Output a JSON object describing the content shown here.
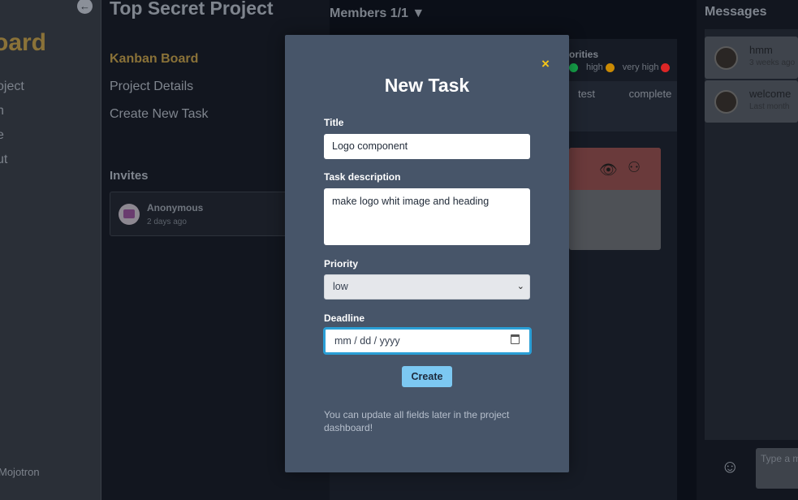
{
  "left_sidebar": {
    "collapse_icon": "arrow-left-icon",
    "brand": "oard",
    "items": [
      "oject",
      "h",
      "e",
      "ut"
    ],
    "user": "Mojotron"
  },
  "project": {
    "title": "Top Secret Project",
    "nav": [
      "Kanban Board",
      "Project Details",
      "Create New Task"
    ],
    "invites_heading": "Invites",
    "invite": {
      "name": "Anonymous",
      "time": "2 days ago"
    }
  },
  "board": {
    "members": "Members 1/1 ▼",
    "priorities_heading": "orities",
    "legend": [
      {
        "label": "high",
        "color": "#ca8a04"
      },
      {
        "label": "very high",
        "color": "#dc2626"
      }
    ],
    "legend_first_dot": "#16a34a",
    "columns": [
      "test",
      "complete"
    ]
  },
  "messages": {
    "heading": "Messages",
    "items": [
      {
        "name": "hmm",
        "time": "3 weeks ago"
      },
      {
        "name": "welcome",
        "time": "Last month"
      }
    ],
    "input_placeholder": "Type a m"
  },
  "modal": {
    "title": "New Task",
    "close_icon": "×",
    "title_label": "Title",
    "title_value": "Logo component",
    "description_label": "Task description",
    "description_value": "make logo whit image and heading",
    "priority_label": "Priority",
    "priority_value": "low",
    "deadline_label": "Deadline",
    "deadline_placeholder": "mm / dd / yyyy",
    "create_label": "Create",
    "note": "You can update all fields later in the project dashboard!"
  },
  "colors": {
    "accent_gold": "#f5c518",
    "modal_bg": "#475569",
    "button_bg": "#7cc8f2",
    "focus_border": "#2a9fd6"
  }
}
